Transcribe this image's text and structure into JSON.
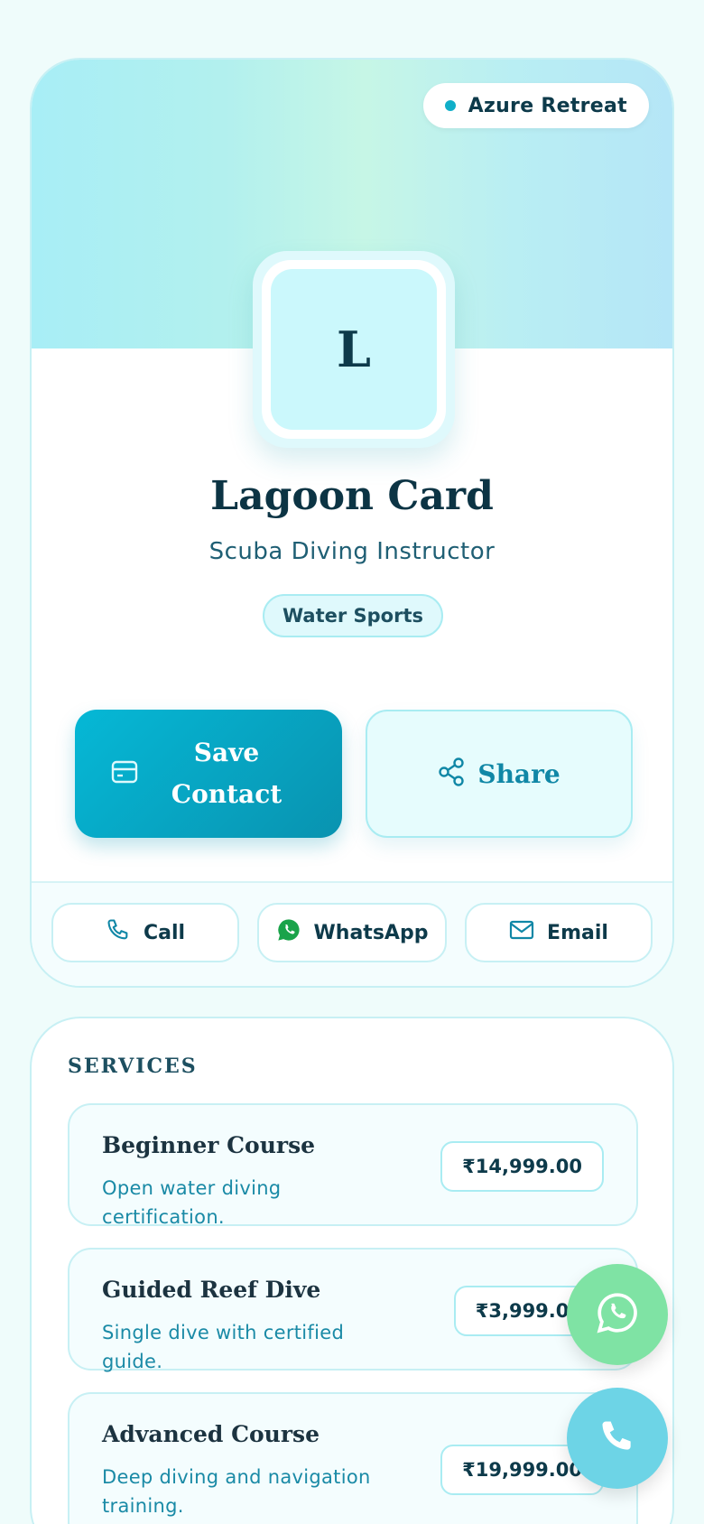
{
  "profile": {
    "badge": "Azure Retreat",
    "initial": "L",
    "name": "Lagoon Card",
    "title": "Scuba Diving Instructor",
    "category": "Water Sports"
  },
  "actions": {
    "save_line1": "Save",
    "save_line2": "Contact",
    "share": "Share"
  },
  "quick": {
    "call": "Call",
    "whatsapp": "WhatsApp",
    "email": "Email"
  },
  "services": {
    "heading": "SERVICES",
    "items": [
      {
        "name": "Beginner Course",
        "desc": "Open water diving certification.",
        "price": "₹14,999.00"
      },
      {
        "name": "Guided Reef Dive",
        "desc": "Single dive with certified guide.",
        "price": "₹3,999.00"
      },
      {
        "name": "Advanced Course",
        "desc": "Deep diving and navigation training.",
        "price": "₹19,999.00"
      }
    ]
  },
  "colors": {
    "accent": "#0aa7c6",
    "whatsapp": "#7fe3a4",
    "call": "#6dd4e6"
  },
  "icons": [
    "card-icon",
    "share-icon",
    "phone-icon",
    "whatsapp-icon",
    "mail-icon"
  ]
}
